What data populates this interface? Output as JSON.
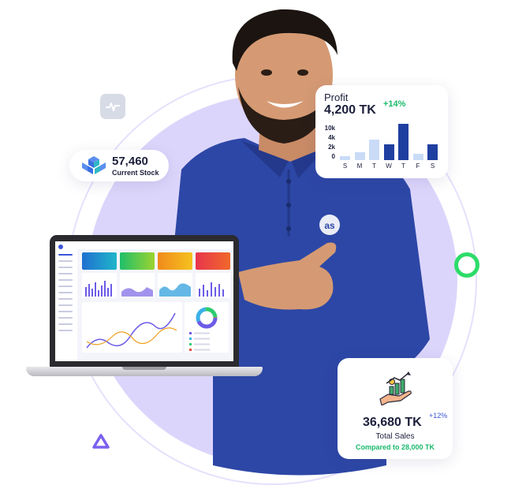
{
  "stock": {
    "value": "57,460",
    "label": "Current Stock",
    "icon": "boxes-icon"
  },
  "profit": {
    "title": "Profit",
    "value": "4,200 TK",
    "change": "+14%",
    "y_ticks": [
      "10k",
      "4k",
      "2k",
      "0"
    ],
    "days": [
      "S",
      "M",
      "T",
      "W",
      "T",
      "F",
      "S"
    ]
  },
  "sales": {
    "value": "36,680 TK",
    "change": "+12%",
    "label": "Total Sales",
    "compare": "Compared to 28,000 TK",
    "icon": "growth-hand-icon"
  },
  "person": {
    "shirt_logo": "as"
  },
  "chart_data": {
    "type": "bar",
    "title": "Profit",
    "categories": [
      "S",
      "M",
      "T",
      "W",
      "T",
      "F",
      "S"
    ],
    "values": [
      1.0,
      2.0,
      5.0,
      4.0,
      9.0,
      1.5,
      4.0
    ],
    "y_ticks": [
      "0",
      "2k",
      "4k",
      "10k"
    ],
    "highlight_indices": [
      3,
      4,
      6
    ],
    "colors": {
      "light": "#c9dbf7",
      "dark": "#1f3fa0"
    }
  },
  "colors": {
    "accent_green": "#19b96b",
    "ring_green": "#2ddc6a",
    "lavender": "#dcd5fb",
    "shirt_blue": "#2d47a6",
    "text_dark": "#1c1f3b"
  }
}
